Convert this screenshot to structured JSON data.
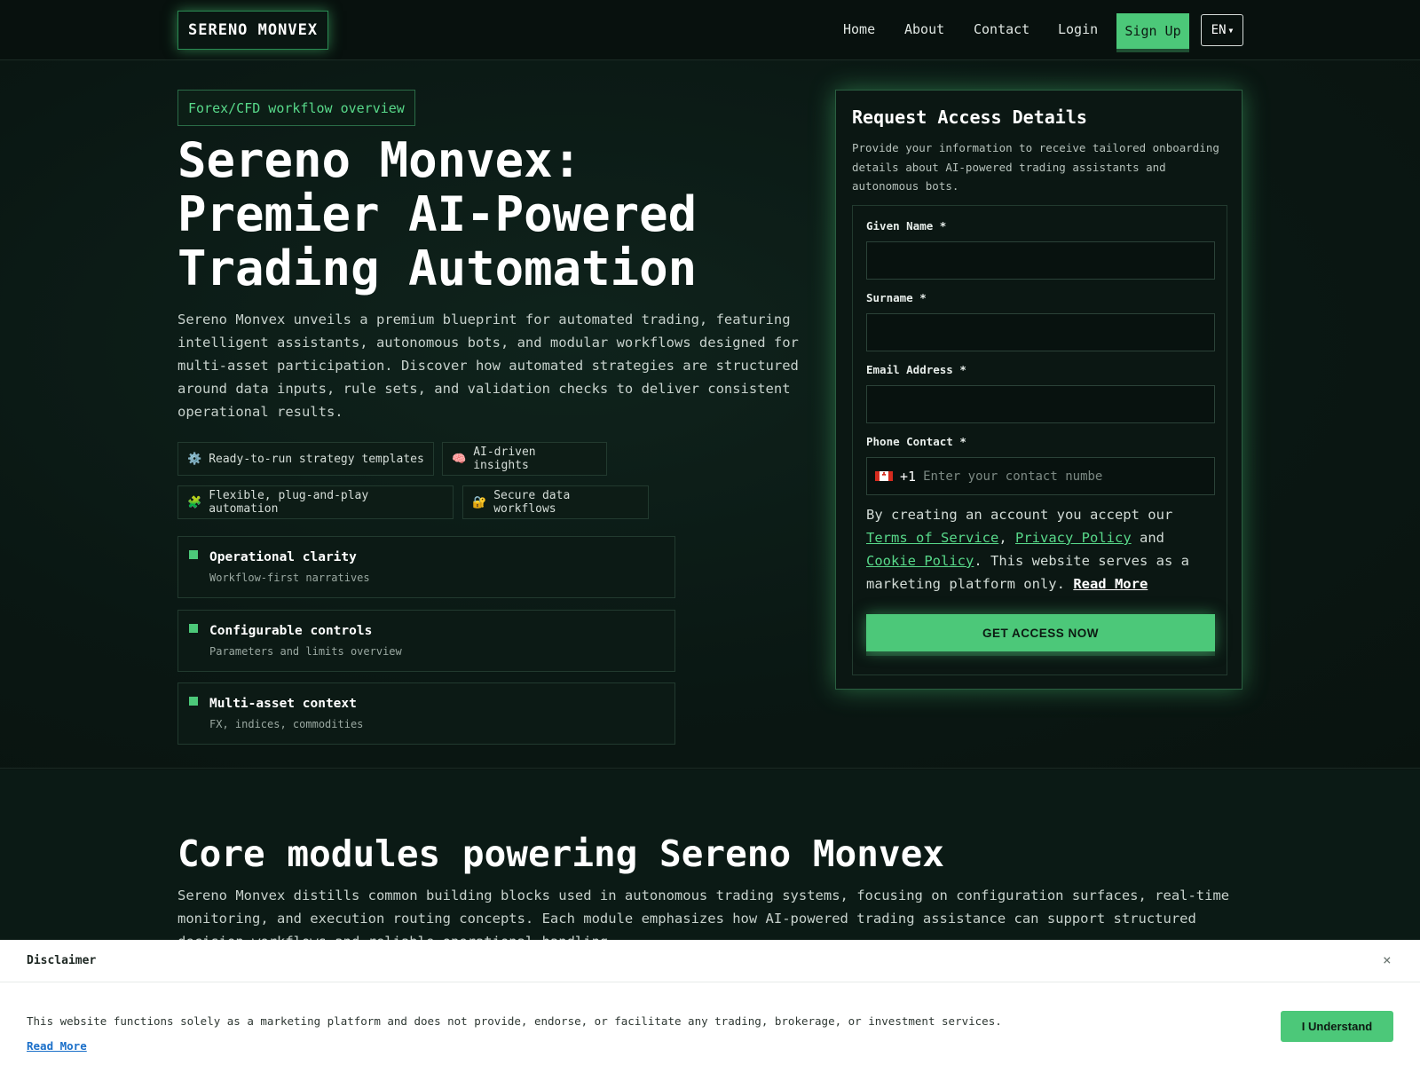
{
  "brand": {
    "logo": "SERENO MONVEX"
  },
  "nav": {
    "items": [
      "Home",
      "About",
      "Contact",
      "Login"
    ],
    "signup": "Sign Up",
    "language": "EN"
  },
  "hero": {
    "tag": "Forex/CFD workflow overview",
    "title": "Sereno Monvex: Premier AI-Powered Trading Automation",
    "description": "Sereno Monvex unveils a premium blueprint for automated trading, featuring intelligent assistants, autonomous bots, and modular workflows designed for multi-asset participation. Discover how automated strategies are structured around data inputs, rule sets, and validation checks to deliver consistent operational results.",
    "chips": [
      {
        "icon": "gear-icon",
        "glyph": "⚙️",
        "label": "Ready-to-run strategy templates"
      },
      {
        "icon": "brain-icon",
        "glyph": "🧠",
        "label": "AI-driven insights"
      },
      {
        "icon": "puzzle-icon",
        "glyph": "🧩",
        "label": "Flexible, plug-and-play automation"
      },
      {
        "icon": "lock-icon",
        "glyph": "🔐",
        "label": "Secure data workflows"
      }
    ],
    "features": [
      {
        "title": "Operational clarity",
        "subtitle": "Workflow-first narratives"
      },
      {
        "title": "Configurable controls",
        "subtitle": "Parameters and limits overview"
      },
      {
        "title": "Multi-asset context",
        "subtitle": "FX, indices, commodities"
      }
    ]
  },
  "form": {
    "title": "Request Access Details",
    "description": "Provide your information to receive tailored onboarding details about AI-powered trading assistants and autonomous bots.",
    "fields": {
      "given_name": "Given Name *",
      "surname": "Surname *",
      "email": "Email Address *",
      "phone": "Phone Contact *"
    },
    "phone_code": "+1",
    "phone_placeholder": "Enter your contact numbe",
    "flag_colors": [
      "#d52b1e",
      "#ffffff",
      "#d52b1e"
    ],
    "legal": {
      "prefix": "By creating an account you accept our",
      "terms": "Terms of Service",
      "comma": ",",
      "privacy": "Privacy Policy",
      "and": "and",
      "cookie": "Cookie Policy",
      "suffix": ". This website serves as a marketing platform only.",
      "read_more": "Read More"
    },
    "submit": "GET ACCESS NOW"
  },
  "modules": {
    "title": "Core modules powering Sereno Monvex",
    "description": "Sereno Monvex distills common building blocks used in autonomous trading systems, focusing on configuration surfaces, real-time monitoring, and execution routing concepts. Each module emphasizes how AI-powered trading assistance can support structured decision workflows and reliable operational handling."
  },
  "disclaimer": {
    "title": "Disclaimer",
    "close": "×",
    "text": "This website functions solely as a marketing platform and does not provide, endorse, or facilitate any trading, brokerage, or investment services.",
    "read_more": "Read More",
    "button": "I Understand"
  },
  "colors": {
    "accent": "#4cc879",
    "background": "#0a1411",
    "link_green": "#58d98a",
    "disclaimer_link": "#1a6fc9"
  }
}
